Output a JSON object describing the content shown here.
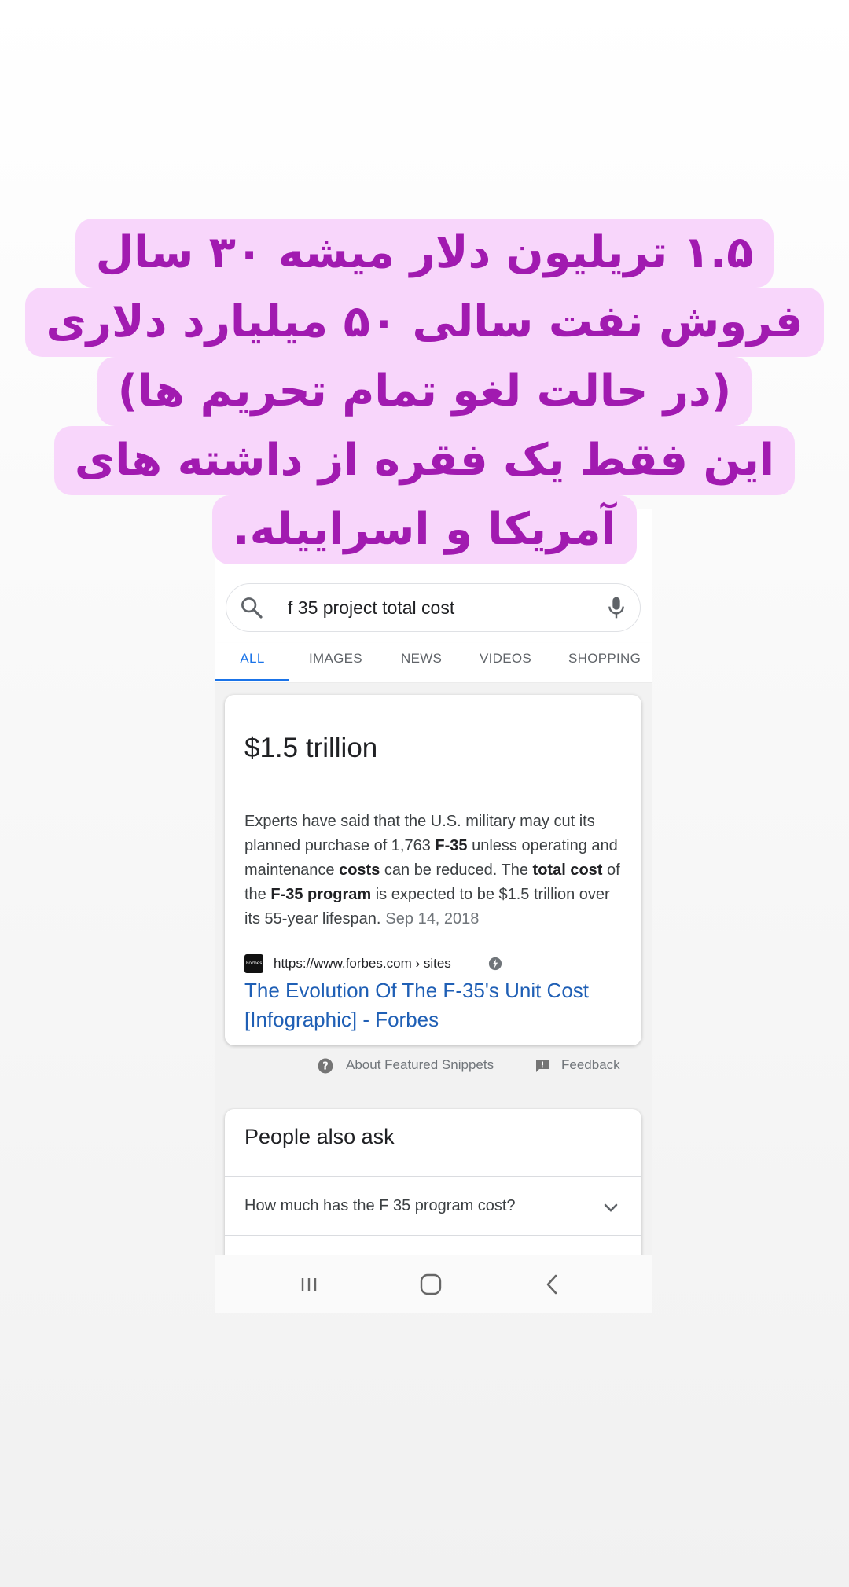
{
  "caption": {
    "lines": [
      "۱.۵ تریلیون دلار میشه ۳۰ سال",
      "فروش نفت سالی ۵۰ میلیارد دلاری",
      "(در حالت لغو تمام تحریم ها)",
      "این فقط یک فقره از داشته های",
      "آمریکا و اسراییله."
    ],
    "text_color": "#a11ab0",
    "highlight_color": "#f8d6fb"
  },
  "search": {
    "query": "f 35 project total cost",
    "search_icon": "search-icon",
    "mic_icon": "mic-icon"
  },
  "tabs": [
    "ALL",
    "IMAGES",
    "NEWS",
    "VIDEOS",
    "SHOPPING"
  ],
  "featured_snippet": {
    "answer": "$1.5 trillion",
    "text_parts": [
      {
        "t": "Experts have said that the U.S. military may cut its planned purchase of 1,763 ",
        "b": false
      },
      {
        "t": "F-35",
        "b": true
      },
      {
        "t": " unless operating and maintenance ",
        "b": false
      },
      {
        "t": "costs",
        "b": true
      },
      {
        "t": " can be reduced. The ",
        "b": false
      },
      {
        "t": "total cost",
        "b": true
      },
      {
        "t": " of the ",
        "b": false
      },
      {
        "t": "F-35 program",
        "b": true
      },
      {
        "t": " is expected to be $1.5 trillion over its 55-year lifespan.",
        "b": false
      }
    ],
    "date": "Sep 14, 2018",
    "favicon_text": "Forbes",
    "source_url": "https://www.forbes.com › sites",
    "result_title": "The Evolution Of The F-35's Unit Cost [Infographic] - Forbes",
    "about_label": "About Featured Snippets",
    "feedback_label": "Feedback"
  },
  "people_also_ask": {
    "title": "People also ask",
    "questions": [
      "How much has the F 35 program cost?"
    ]
  },
  "colors": {
    "accent_blue": "#1a73e8",
    "link_blue": "#1f5fb5"
  },
  "nav_bar": {
    "icons": [
      "recents-icon",
      "home-icon",
      "back-icon"
    ]
  }
}
